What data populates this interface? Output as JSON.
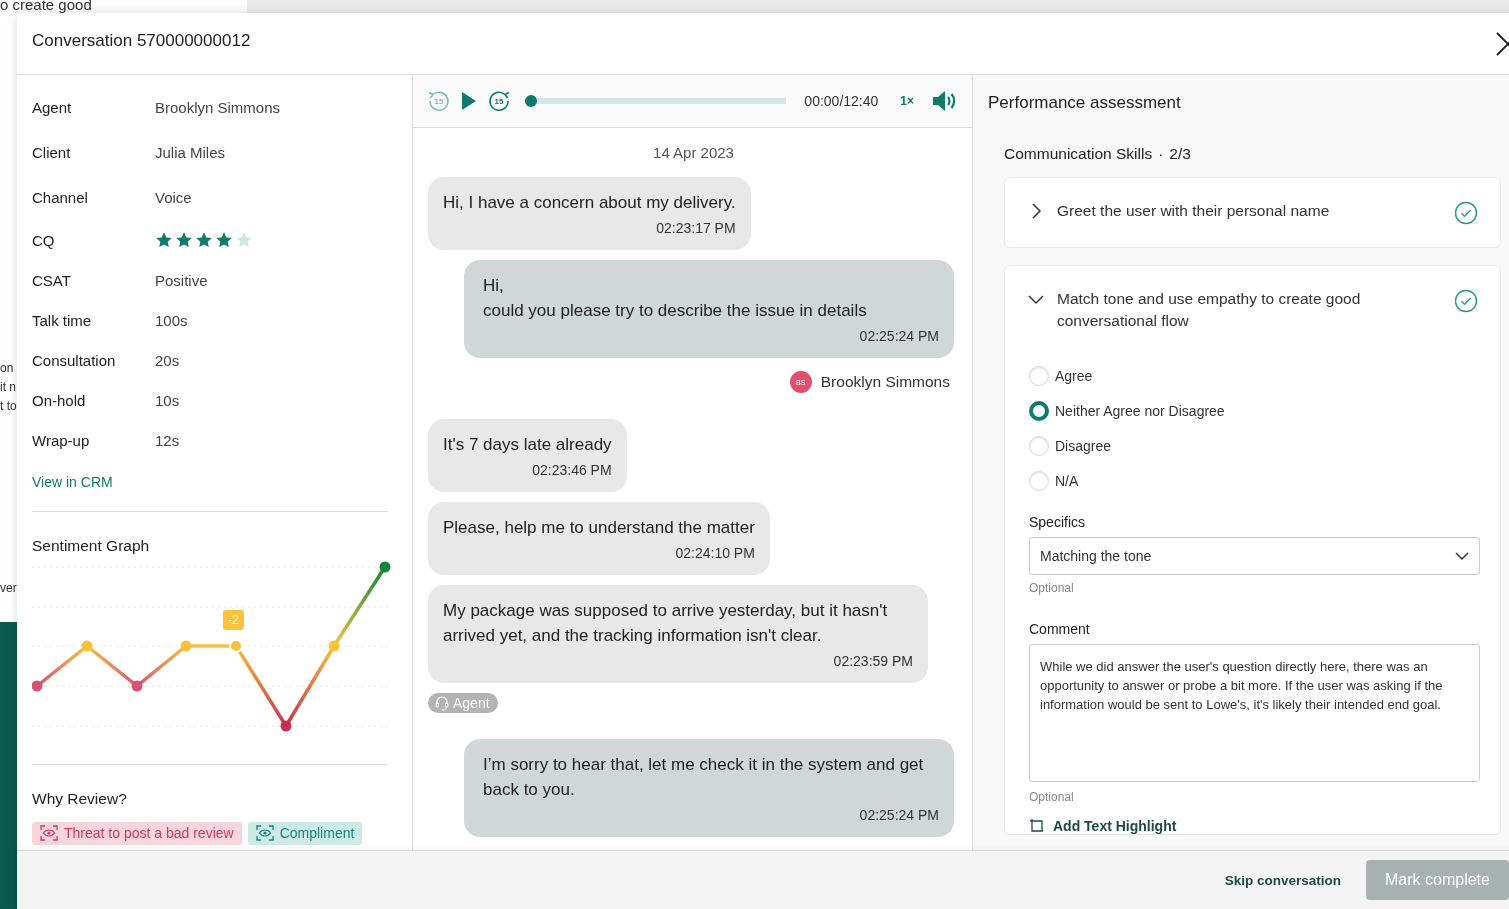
{
  "backdrop": {
    "fragments": [
      {
        "text": "o create good"
      },
      {
        "text": "on"
      },
      {
        "text": "it n"
      },
      {
        "text": "t to"
      },
      {
        "text": "ver"
      }
    ]
  },
  "dialog": {
    "title": "Conversation 570000000012"
  },
  "details": [
    {
      "label": "Agent",
      "kind": "text",
      "value": "Brooklyn Simmons"
    },
    {
      "label": "Client",
      "kind": "text",
      "value": "Julia Miles"
    },
    {
      "label": "Channel",
      "kind": "text",
      "value": "Voice"
    },
    {
      "label": "CQ",
      "kind": "stars",
      "stars": 4
    },
    {
      "label": "CSAT",
      "kind": "text",
      "value": "Positive"
    },
    {
      "label": "Talk time",
      "kind": "text",
      "value": "100s"
    },
    {
      "label": "Consultation",
      "kind": "text",
      "value": "20s"
    },
    {
      "label": "On-hold",
      "kind": "text",
      "value": "10s"
    },
    {
      "label": "Wrap-up",
      "kind": "text",
      "value": "12s"
    }
  ],
  "crm_link": "View in CRM",
  "sentiment": {
    "title": "Sentiment Graph",
    "tooltip": "-2"
  },
  "why_review": {
    "title": "Why Review?",
    "tags": [
      {
        "label": "Threat to post a bad review",
        "kind": "negative"
      },
      {
        "label": "Compliment",
        "kind": "positive"
      }
    ]
  },
  "player": {
    "rewind": "15",
    "rewind_disabled": true,
    "forward": "15",
    "level": 0,
    "time": "00:00/12:40",
    "speed": "1×"
  },
  "messages": [
    {
      "kind": "date",
      "text": "14 Apr 2023"
    },
    {
      "kind": "client",
      "text": "Hi, I have a concern about my delivery.",
      "time": "02:23:17 PM"
    },
    {
      "kind": "agent",
      "text": "Hi,\ncould you please try to describe the issue in details",
      "time": "02:25:24 PM"
    },
    {
      "kind": "author",
      "name": "Brooklyn Simmons",
      "initials": "BS"
    },
    {
      "kind": "client",
      "text": "It's 7 days late already",
      "time": "02:23:46 PM"
    },
    {
      "kind": "client",
      "text": "Please, help me to understand the matter",
      "time": "02:24:10 PM"
    },
    {
      "kind": "client",
      "text": "My package was supposed to arrive yesterday, but it hasn't arrived yet, and the tracking information isn't clear.",
      "time": "02:23:59 PM"
    },
    {
      "kind": "role",
      "text": "Agent"
    },
    {
      "kind": "agent",
      "text": "I’m sorry to hear that, let me check it in the system and get back to you.",
      "time": "02:25:24 PM"
    }
  ],
  "assessment": {
    "title": "Performance assessment",
    "section": "Communication Skills",
    "separator": "·",
    "progress": "2/3",
    "questions": [
      {
        "text": "Greet the user with their personal name",
        "expanded": false,
        "done": true
      },
      {
        "text": "Match tone and use empathy to create good conversational flow",
        "expanded": true,
        "done": true,
        "options": [
          {
            "label": "Agree",
            "selected": false
          },
          {
            "label": "Neither Agree nor Disagree",
            "selected": true
          },
          {
            "label": "Disagree",
            "selected": false
          },
          {
            "label": "N/A",
            "selected": false
          }
        ],
        "specifics": {
          "label": "Specifics",
          "value": "Matching the tone",
          "hint": "Optional"
        },
        "comment": {
          "label": "Comment",
          "value": "While we did answer the user's question directly here, there was an opportunity to answer or probe a bit more. If the user was asking if the information would be sent to Lowe's, it's likely their intended end goal.",
          "hint": "Optional"
        },
        "highlight": "Add Text Highlight"
      }
    ]
  },
  "footer": {
    "skip": "Skip conversation",
    "complete": "Mark complete",
    "complete_disabled": true
  }
}
